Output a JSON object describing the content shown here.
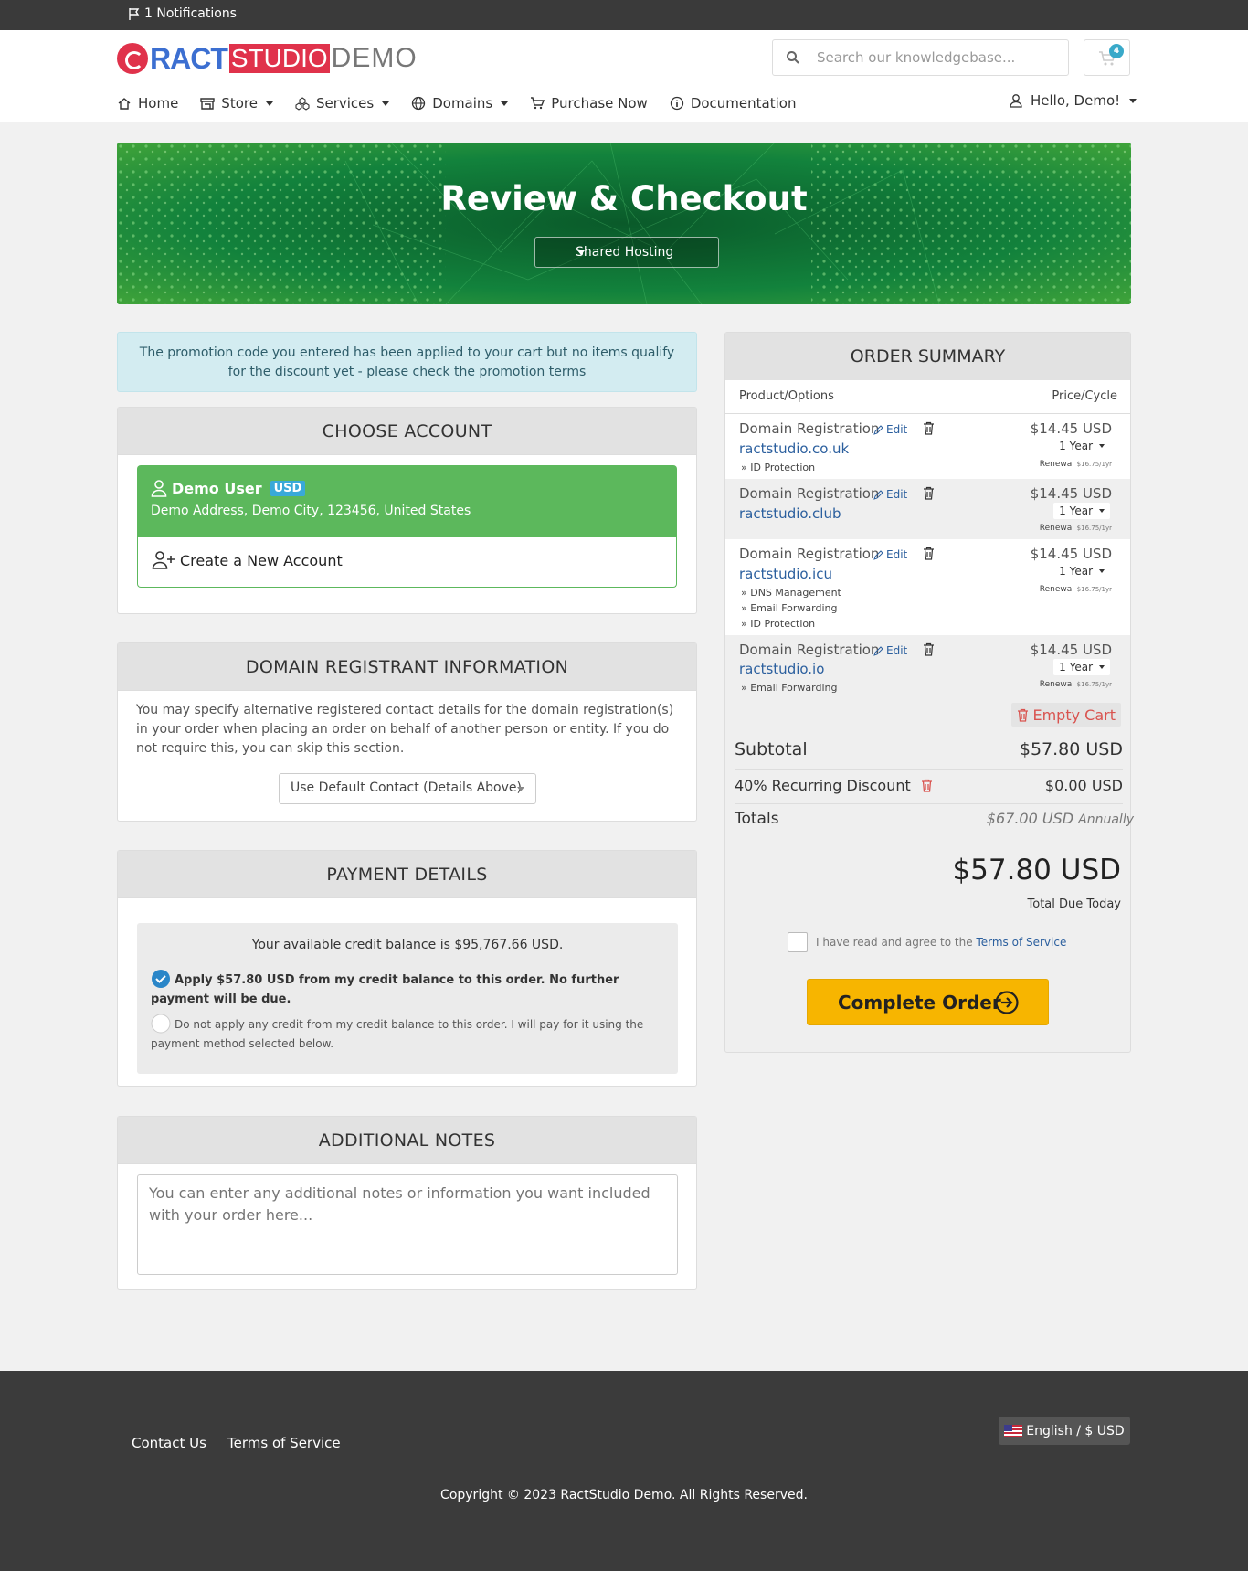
{
  "topbar": {
    "notifications": "1 Notifications"
  },
  "brand": {
    "part1": "RACT",
    "part2": "STUDIO",
    "part3": "DEMO"
  },
  "search": {
    "placeholder": "Search our knowledgebase..."
  },
  "cart": {
    "count": "4"
  },
  "nav": {
    "items": [
      {
        "label": "Home",
        "icon": "home-icon",
        "dropdown": false
      },
      {
        "label": "Store",
        "icon": "store-icon",
        "dropdown": true
      },
      {
        "label": "Services",
        "icon": "services-icon",
        "dropdown": true
      },
      {
        "label": "Domains",
        "icon": "globe-icon",
        "dropdown": true
      },
      {
        "label": "Purchase Now",
        "icon": "cart-icon",
        "dropdown": false
      },
      {
        "label": "Documentation",
        "icon": "info-icon",
        "dropdown": false
      }
    ],
    "user": "Hello, Demo!"
  },
  "banner": {
    "title": "Review & Checkout",
    "category": "Shared Hosting"
  },
  "alert": {
    "text": "The promotion code you entered has been applied to your cart but no items qualify for the discount yet - please check the promotion terms"
  },
  "choose_account": {
    "title": "CHOOSE ACCOUNT",
    "selected_name": "Demo User",
    "selected_currency": "USD",
    "selected_address": "Demo Address, Demo City, 123456, United States",
    "new_account": "Create a New Account"
  },
  "registrant": {
    "title": "DOMAIN REGISTRANT INFORMATION",
    "text": "You may specify alternative registered contact details for the domain registration(s) in your order when placing an order on behalf of another person or entity. If you do not require this, you can skip this section.",
    "select_value": "Use Default Contact (Details Above)"
  },
  "payment": {
    "title": "PAYMENT DETAILS",
    "balance_text": "Your available credit balance is $95,767.66 USD.",
    "apply_text": "Apply $57.80 USD from my credit balance to this order. No further payment will be due.",
    "noapply_text": "Do not apply any credit from my credit balance to this order. I will pay for it using the payment method selected below."
  },
  "notes": {
    "title": "ADDITIONAL NOTES",
    "placeholder": "You can enter any additional notes or information you want included with your order here..."
  },
  "summary": {
    "title": "ORDER SUMMARY",
    "col_product": "Product/Options",
    "col_price": "Price/Cycle",
    "edit_label": "Edit",
    "items": [
      {
        "name": "Domain Registration",
        "domain": "ractstudio.co.uk",
        "price": "$14.45 USD",
        "cycle": "1 Year",
        "renewal_label": "Renewal",
        "renewal_value": "$16.75/1yr",
        "options": [
          "» ID Protection"
        ]
      },
      {
        "name": "Domain Registration",
        "domain": "ractstudio.club",
        "price": "$14.45 USD",
        "cycle": "1 Year",
        "renewal_label": "Renewal",
        "renewal_value": "$16.75/1yr",
        "options": []
      },
      {
        "name": "Domain Registration",
        "domain": "ractstudio.icu",
        "price": "$14.45 USD",
        "cycle": "1 Year",
        "renewal_label": "Renewal",
        "renewal_value": "$16.75/1yr",
        "options": [
          "» DNS Management",
          "» Email Forwarding",
          "» ID Protection"
        ]
      },
      {
        "name": "Domain Registration",
        "domain": "ractstudio.io",
        "price": "$14.45 USD",
        "cycle": "1 Year",
        "renewal_label": "Renewal",
        "renewal_value": "$16.75/1yr",
        "options": [
          "» Email Forwarding"
        ]
      }
    ],
    "empty_cart": "Empty Cart",
    "subtotal_label": "Subtotal",
    "subtotal_value": "$57.80 USD",
    "discount_label": "40% Recurring Discount",
    "discount_value": "$0.00 USD",
    "totals_label": "Totals",
    "totals_value": "$67.00 USD",
    "totals_cycle": "Annually",
    "due_amount": "$57.80 USD",
    "due_label": "Total Due Today",
    "tos_prefix": "I have read and agree to the",
    "tos_link": "Terms of Service",
    "complete_button": "Complete Order"
  },
  "footer": {
    "contact": "Contact Us",
    "terms": "Terms of Service",
    "language": "English / $ USD",
    "copyright": "Copyright © 2023 RactStudio Demo. All Rights Reserved."
  },
  "colors": {
    "primary_green": "#5cb85c",
    "banner_green": "#107a3a",
    "accent_yellow": "#f7b500",
    "link_blue": "#2b5f9e",
    "danger_red": "#d9534f"
  }
}
